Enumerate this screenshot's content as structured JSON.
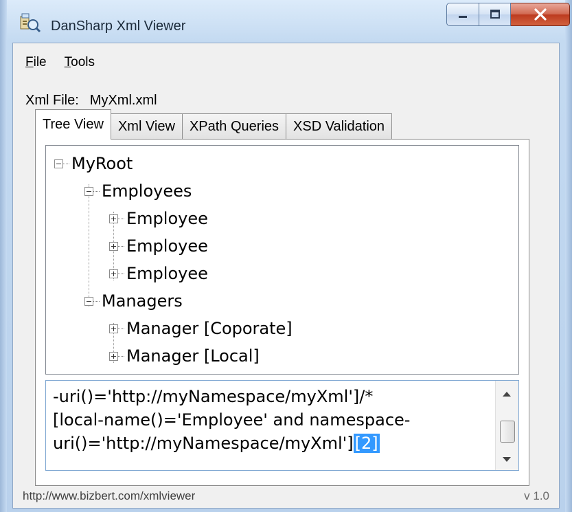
{
  "window": {
    "title": "DanSharp Xml Viewer",
    "controls": {
      "minimize": "minimize",
      "maximize": "maximize",
      "close": "close"
    }
  },
  "menu": {
    "items": [
      {
        "accel": "F",
        "rest": "ile"
      },
      {
        "accel": "T",
        "rest": "ools"
      }
    ]
  },
  "file": {
    "label": "Xml File:",
    "name": "MyXml.xml"
  },
  "tabs": [
    {
      "label": "Tree View",
      "active": true
    },
    {
      "label": "Xml View",
      "active": false
    },
    {
      "label": "XPath Queries",
      "active": false
    },
    {
      "label": "XSD Validation",
      "active": false
    }
  ],
  "tree": {
    "nodes": [
      {
        "label": "MyRoot",
        "level": 0,
        "expanded": true
      },
      {
        "label": "Employees",
        "level": 1,
        "expanded": true
      },
      {
        "label": "Employee",
        "level": 2,
        "expanded": false
      },
      {
        "label": "Employee",
        "level": 2,
        "expanded": false
      },
      {
        "label": "Employee",
        "level": 2,
        "expanded": false
      },
      {
        "label": "Managers",
        "level": 1,
        "expanded": true
      },
      {
        "label": "Manager [Coporate]",
        "level": 2,
        "expanded": false
      },
      {
        "label": "Manager [Local]",
        "level": 2,
        "expanded": false
      }
    ]
  },
  "xpath": {
    "line1": "-uri()='http://myNamespace/myXml']/*",
    "line2": "[local-name()='Employee' and namespace-",
    "line3": "uri()='http://myNamespace/myXml']",
    "selected": "[2]"
  },
  "status": {
    "url": "http://www.bizbert.com/xmlviewer",
    "version": "v 1.0"
  },
  "colors": {
    "selection": "#3399ff",
    "frame": "#c4daf1",
    "close_button": "#c8452a"
  }
}
